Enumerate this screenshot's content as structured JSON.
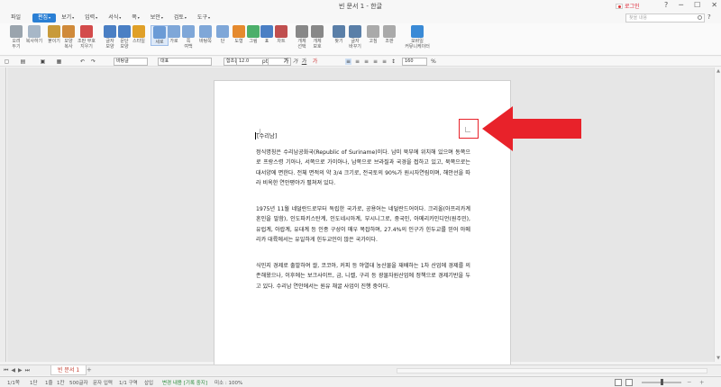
{
  "window": {
    "title": "빈 문서 1 - 한글",
    "lang_label": "로그인",
    "controls": [
      "?",
      "─",
      "☐",
      "✕"
    ]
  },
  "menubar": {
    "file": "파일",
    "items": [
      {
        "label": "편집",
        "active": true
      },
      {
        "label": "보기"
      },
      {
        "label": "입력"
      },
      {
        "label": "서식"
      },
      {
        "label": "쪽"
      },
      {
        "label": "보안"
      },
      {
        "label": "검토"
      },
      {
        "label": "도구"
      }
    ],
    "search_placeholder": "찾을 내용",
    "help": "?"
  },
  "ribbon": {
    "buttons": [
      {
        "label": "오려\n두기",
        "icon": "scissors-icon",
        "color": "#9aa4ad"
      },
      {
        "label": "복사하기",
        "icon": "copy-icon",
        "color": "#a7b7c7"
      },
      {
        "label": "붙이기",
        "icon": "paste-icon",
        "color": "#c89a3a"
      },
      {
        "label": "모양\n복사",
        "icon": "format-painter-icon",
        "color": "#d08a3a"
      },
      {
        "label": "조판 부호\n지우기",
        "icon": "clear-marks-icon",
        "color": "#d34b4b"
      },
      {
        "label": "글자\n모양",
        "icon": "char-shape-icon",
        "color": "#4a7fc4"
      },
      {
        "label": "문단\n모양",
        "icon": "para-shape-icon",
        "color": "#4a7fc4"
      },
      {
        "label": "스타일",
        "icon": "style-icon",
        "color": "#e0a028"
      },
      {
        "label": "세로",
        "icon": "portrait-icon",
        "color": "#6b9bd6",
        "selected": true
      },
      {
        "label": "가로",
        "icon": "landscape-icon",
        "color": "#7fa7d8"
      },
      {
        "label": "쪽\n여백",
        "icon": "margin-icon",
        "color": "#7fa7d8"
      },
      {
        "label": "바탕쪽",
        "icon": "master-page-icon",
        "color": "#7fa7d8"
      },
      {
        "label": "단",
        "icon": "columns-icon",
        "color": "#7fa7d8"
      },
      {
        "label": "도형",
        "icon": "shape-icon",
        "color": "#e58a2e"
      },
      {
        "label": "그림",
        "icon": "picture-icon",
        "color": "#4caf6a"
      },
      {
        "label": "표",
        "icon": "table-icon",
        "color": "#4a7fc4"
      },
      {
        "label": "차트",
        "icon": "chart-icon",
        "color": "#c04f4f"
      },
      {
        "label": "개체\n선택",
        "icon": "object-select-icon",
        "color": "#888888"
      },
      {
        "label": "개체\n보호",
        "icon": "object-protect-icon",
        "color": "#888888"
      },
      {
        "label": "찾기",
        "icon": "find-icon",
        "color": "#5a7fa8"
      },
      {
        "label": "글자\n바꾸기",
        "icon": "replace-icon",
        "color": "#5a7fa8"
      },
      {
        "label": "고침",
        "icon": "edit-icon",
        "color": "#aaaaaa"
      },
      {
        "label": "조판",
        "icon": "layout-icon",
        "color": "#aaaaaa"
      },
      {
        "label": "모바일\n커뮤니케이터",
        "icon": "mobile-icon",
        "color": "#3a8ad6"
      }
    ]
  },
  "format_bar": {
    "style": "바탕글",
    "lang": "대표",
    "font": "함초롬바탕",
    "size": "12.0",
    "unit": "pt",
    "zoom": "160",
    "zoom_unit": "%"
  },
  "document": {
    "heading": "[수리남]",
    "paragraphs": [
      "정식명칭은 수리남공화국(Republic of Suriname)이다. 남미 북부에 위치해 있으며 동쪽으로 프랑스령 기아나, 서쪽으로 가이아나, 남쪽으로 브라질과 국경을 접하고 있고, 북쪽으로는 대서양에 면한다. 전체 면적의 약 3/4 크기로, 전국토의 90%가 원시자연림이며, 해안선을 따라 비옥한 연안평야가 펼쳐져 있다.",
      "1975년 11월 네덜란드로부터 독립한 국가로, 공용어는 네덜란드어이다. 크리올(아프리카계 혼인을 말함), 인도파키스탄계, 인도네시아계, 부시니그로, 중국인, 아메리카인디언(원주민), 유럽계, 아랍계, 유대계 등 인종 구성이 매우 복잡하며, 27.4%의 인구가 힌두교를 믿어 아메리카 대륙에서는 유일하게 힌두교인이 많은 국가이다.",
      "식민지 경제로 출발하여 쌀, 코코아, 커피 등 야열대 농산물을 재배하는 1차 산업에 경제를 의존해왔으나, 이후에는 보크사이트, 금, 니켈, 구리 등 광물자원산업에 정책으로 경제기반을 두고 있다. 수리남 연안에서는 원유 채굴 사업이 진행 중이다."
    ]
  },
  "tabs": {
    "doc_tab": "빈 문서 1",
    "add": "+"
  },
  "status": {
    "page": "1/1쪽",
    "section": "1단",
    "line": "1줄",
    "col": "1칸",
    "chars": "500글자",
    "mode": "문자 입력",
    "area": "1/1 구역",
    "insert": "삽입",
    "track": "변경 내용 [기록 중지]",
    "pos": "미소 : 100%"
  },
  "annotation_color": "#e8222a"
}
